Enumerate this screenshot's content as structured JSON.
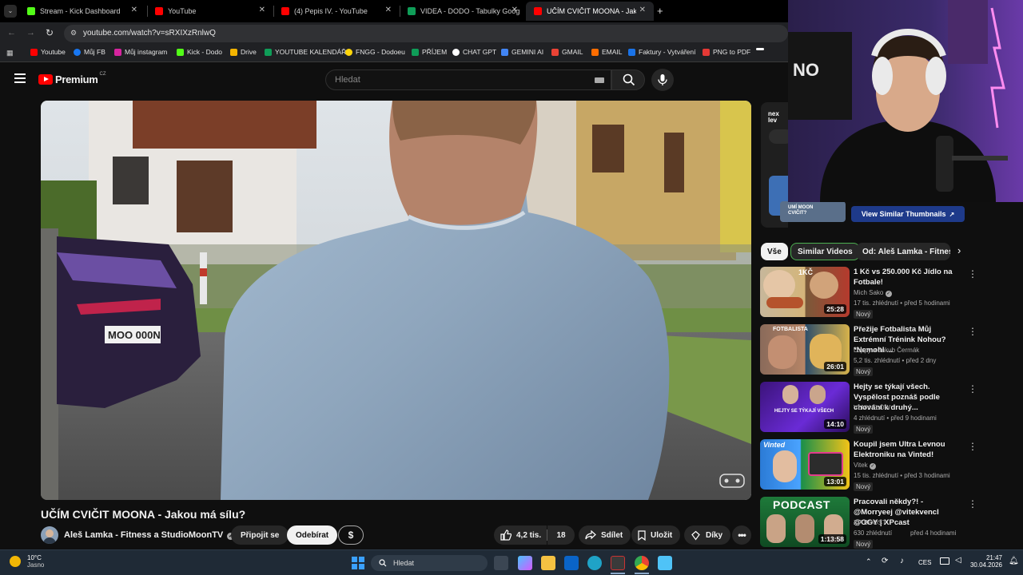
{
  "tabs": [
    {
      "label": "Stream - Kick Dashboard",
      "color": "#53fc18"
    },
    {
      "label": "YouTube",
      "color": "#ff0000"
    },
    {
      "label": "(4) Pepis IV. - YouTube",
      "color": "#ff0000"
    },
    {
      "label": "VIDEA - DODO - Tabulky Googl",
      "color": "#0f9d58"
    },
    {
      "label": "UČÍM CVIČIT MOONA - Jakou m",
      "color": "#ff0000"
    }
  ],
  "address": {
    "url": "youtube.com/watch?v=sRXIXzRnlwQ"
  },
  "bookmarks": [
    "Youtube",
    "Můj FB",
    "Můj instagram",
    "Kick - Dodo",
    "Drive",
    "YOUTUBE KALENDÁŘ",
    "FNGG - Dodoeu",
    "PŘÍJEM",
    "CHAT GPT",
    "GEMINI AI",
    "GMAIL",
    "EMAIL",
    "Faktury - Vytváření",
    "PNG to PDF"
  ],
  "yt_header": {
    "logo": "Premium",
    "region": "CZ",
    "search_placeholder": "Hledat"
  },
  "video": {
    "title": "UČÍM CVIČIT MOONA - Jakou má sílu?",
    "plate": "MOO 000N",
    "channel": "Aleš Lamka - Fitness a StudioMoonTV",
    "join": "Připojit se",
    "subscribe": "Odebírat",
    "likes": "4,2 tis.",
    "dislikes": "18",
    "share": "Sdílet",
    "save": "Uložit",
    "thanks": "Díky"
  },
  "extension": {
    "button": "View Similar Thumbnails",
    "logo": "nex lev",
    "thumb_text": "UMÍ MOON CVIČIT?"
  },
  "chips": [
    "Vše",
    "Similar Videos",
    "Od: Aleš Lamka - Fitness"
  ],
  "recs": [
    {
      "title": "1 Kč vs 250.000 Kč Jídlo na Fotbale!",
      "channel": "Mich Sako",
      "views": "17 tis. zhlédnutí",
      "time": "před 5 hodinami",
      "badge": "Nový",
      "duration": "25:28",
      "thumb_text": "1KČ"
    },
    {
      "title": "Přežije Fotbalista Můj Extrémní Trénink Nohou? *Nemohl ...",
      "channel": "Loppy a Jakub Čermák",
      "views": "5,2 tis. zhlédnutí",
      "time": "před 2 dny",
      "badge": "Nový",
      "duration": "26:01",
      "thumb_text": "FOTBALISTA"
    },
    {
      "title": "Hejty se týkají všech. Vyspělost poznáš podle chování k druhý...",
      "channel": "VLNY FLOW",
      "views": "4 zhlédnutí",
      "time": "před 9 hodinami",
      "badge": "Nový",
      "duration": "14:10",
      "thumb_text": "HEJTY SE TÝKAJÍ VŠECH"
    },
    {
      "title": "Koupil jsem Ultra Levnou Elektroniku na Vinted!",
      "channel": "Vitek",
      "views": "15 tis. zhlédnutí",
      "time": "před 3 hodinami",
      "badge": "Nový",
      "duration": "13:01",
      "thumb_text": "Vinted"
    },
    {
      "title": "Pracovali někdy?! - @Morryeej @vitekvencl @OGY | XPcast",
      "channel": "XP BOOST",
      "views": "630 zhlédnutí",
      "time": "před 4 hodinami",
      "badge": "Nový",
      "duration": "1:13:58",
      "thumb_text": "PODCAST"
    }
  ],
  "taskbar": {
    "temp": "10°C",
    "weather": "Jasno",
    "search": "Hledat",
    "lang": "CES",
    "time": "21:47",
    "date": "30.04.2026"
  }
}
